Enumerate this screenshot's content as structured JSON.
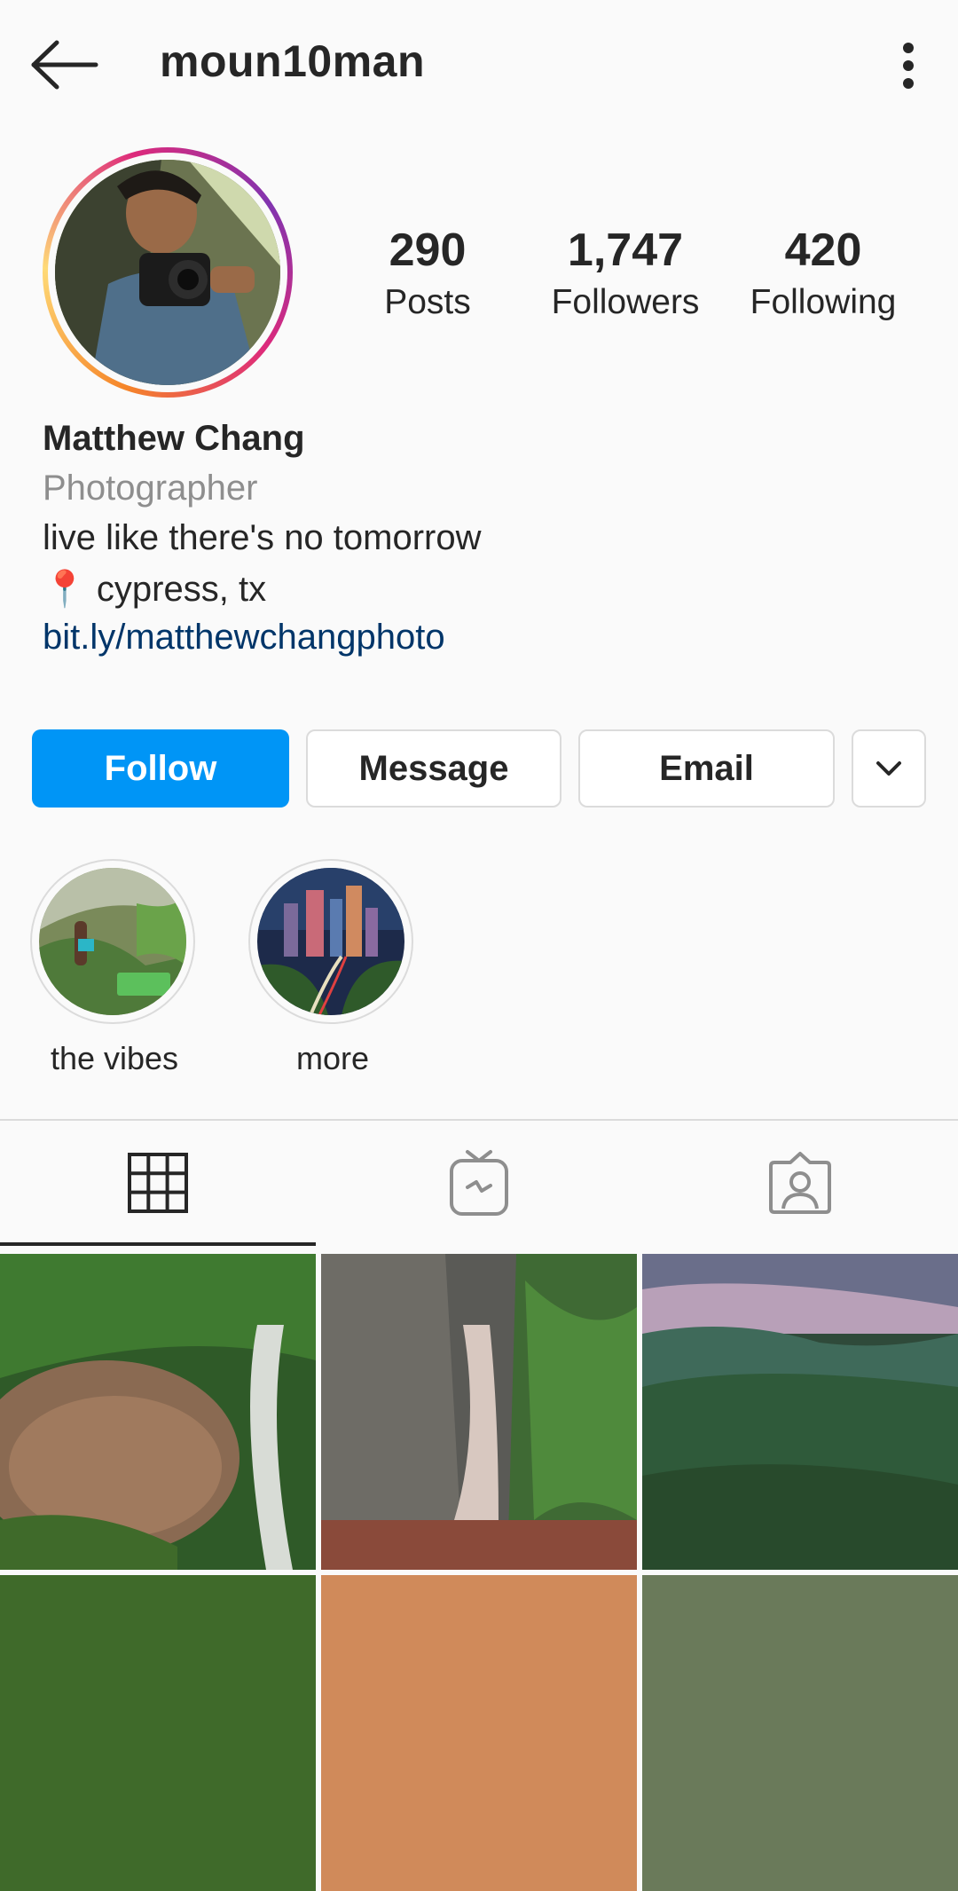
{
  "header": {
    "username": "moun10man"
  },
  "profile": {
    "stats": [
      {
        "value": "290",
        "label": "Posts"
      },
      {
        "value": "1,747",
        "label": "Followers"
      },
      {
        "value": "420",
        "label": "Following"
      }
    ],
    "name": "Matthew Chang",
    "category": "Photographer",
    "bio": "live like there's no tomorrow",
    "location": "📍 cypress, tx",
    "link": "bit.ly/matthewchangphoto"
  },
  "actions": {
    "follow": "Follow",
    "message": "Message",
    "email": "Email"
  },
  "highlights": [
    {
      "label": "the vibes"
    },
    {
      "label": "more"
    }
  ],
  "colors": {
    "accent": "#0095f6",
    "link": "#003569",
    "secondary_text": "#8e8e8e"
  }
}
